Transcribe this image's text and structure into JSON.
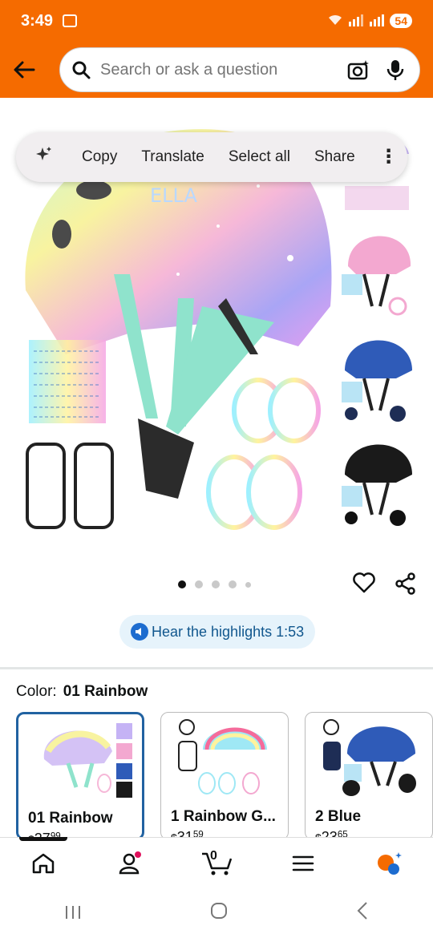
{
  "status": {
    "time": "3:49",
    "battery": "54"
  },
  "search": {
    "placeholder": "Search or ask a question"
  },
  "context_menu": {
    "copy": "Copy",
    "translate": "Translate",
    "select_all": "Select all",
    "share": "Share"
  },
  "gallery": {
    "dots_count": 5,
    "active_index": 0,
    "helmet_text": "ELLA"
  },
  "highlights": {
    "label": "Hear the highlights 1:53"
  },
  "color": {
    "label": "Color:",
    "selected": "01 Rainbow"
  },
  "variants": [
    {
      "name": "01 Rainbow",
      "price_symbol": "$",
      "price_whole": "27",
      "price_fraction": "99"
    },
    {
      "name": "1 Rainbow G...",
      "price_symbol": "$",
      "price_whole": "31",
      "price_fraction": "59"
    },
    {
      "name": "2 Blue",
      "price_symbol": "$",
      "price_whole": "23",
      "price_fraction": "65"
    }
  ],
  "cart": {
    "count": "0"
  },
  "colors": {
    "brand_orange": "#f56b00",
    "selected_border": "#2162a1",
    "highlight_text": "#11578e"
  }
}
